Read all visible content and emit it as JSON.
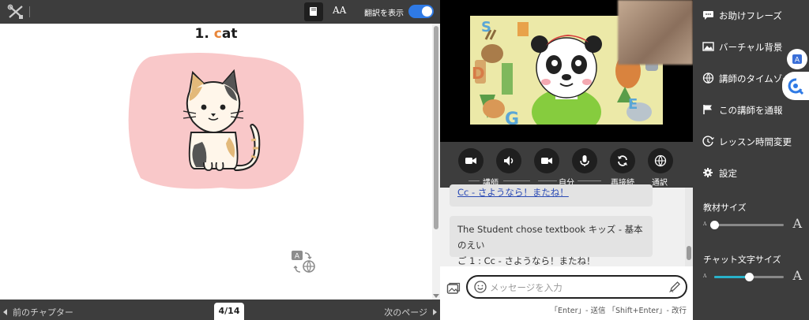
{
  "textbook": {
    "toggle_label": "翻訳を表示",
    "font_size_label": "AA",
    "title_number": "1. ",
    "title_first": "c",
    "title_rest": "at",
    "page_indicator": "4/14",
    "prev_chapter": "前のチャプター",
    "next_page": "次のページ",
    "translation_on": true,
    "colors": {
      "accent": "#2f7ae5",
      "card_bg": "#f9c8c9",
      "title_c": "#e8863a"
    }
  },
  "video": {
    "controls": {
      "teacher_label": "講師",
      "self_label": "自分",
      "reconnect_label": "再接続",
      "translate_label": "通訳"
    }
  },
  "chat": {
    "messages": [
      {
        "text": "Cc - さようなら！またね！",
        "link": true
      },
      {
        "text_line1": "The Student chose textbook キッズ - 基本のえい",
        "text_line2": "ご 1 : Cc - さようなら！またね！"
      }
    ],
    "input_placeholder": "メッセージを入力",
    "hint": "「Enter」- 送信 「Shift+Enter」- 改行"
  },
  "sidebar": {
    "items": [
      {
        "label": "お助けフレーズ",
        "icon": "speech-bubble-icon"
      },
      {
        "label": "バーチャル背景",
        "icon": "image-icon"
      },
      {
        "label": "講師のタイムゾーン",
        "icon": "globe-icon"
      },
      {
        "label": "この講師を通報",
        "icon": "flag-icon"
      },
      {
        "label": "レッスン時間変更",
        "icon": "clock-icon"
      },
      {
        "label": "設定",
        "icon": "gear-icon"
      }
    ],
    "material_size_label": "教材サイズ",
    "chat_text_size_label": "チャット文字サイズ",
    "slider_small": "A",
    "slider_big": "A",
    "material_size_level": 0.0,
    "chat_text_size_level": 0.5
  }
}
